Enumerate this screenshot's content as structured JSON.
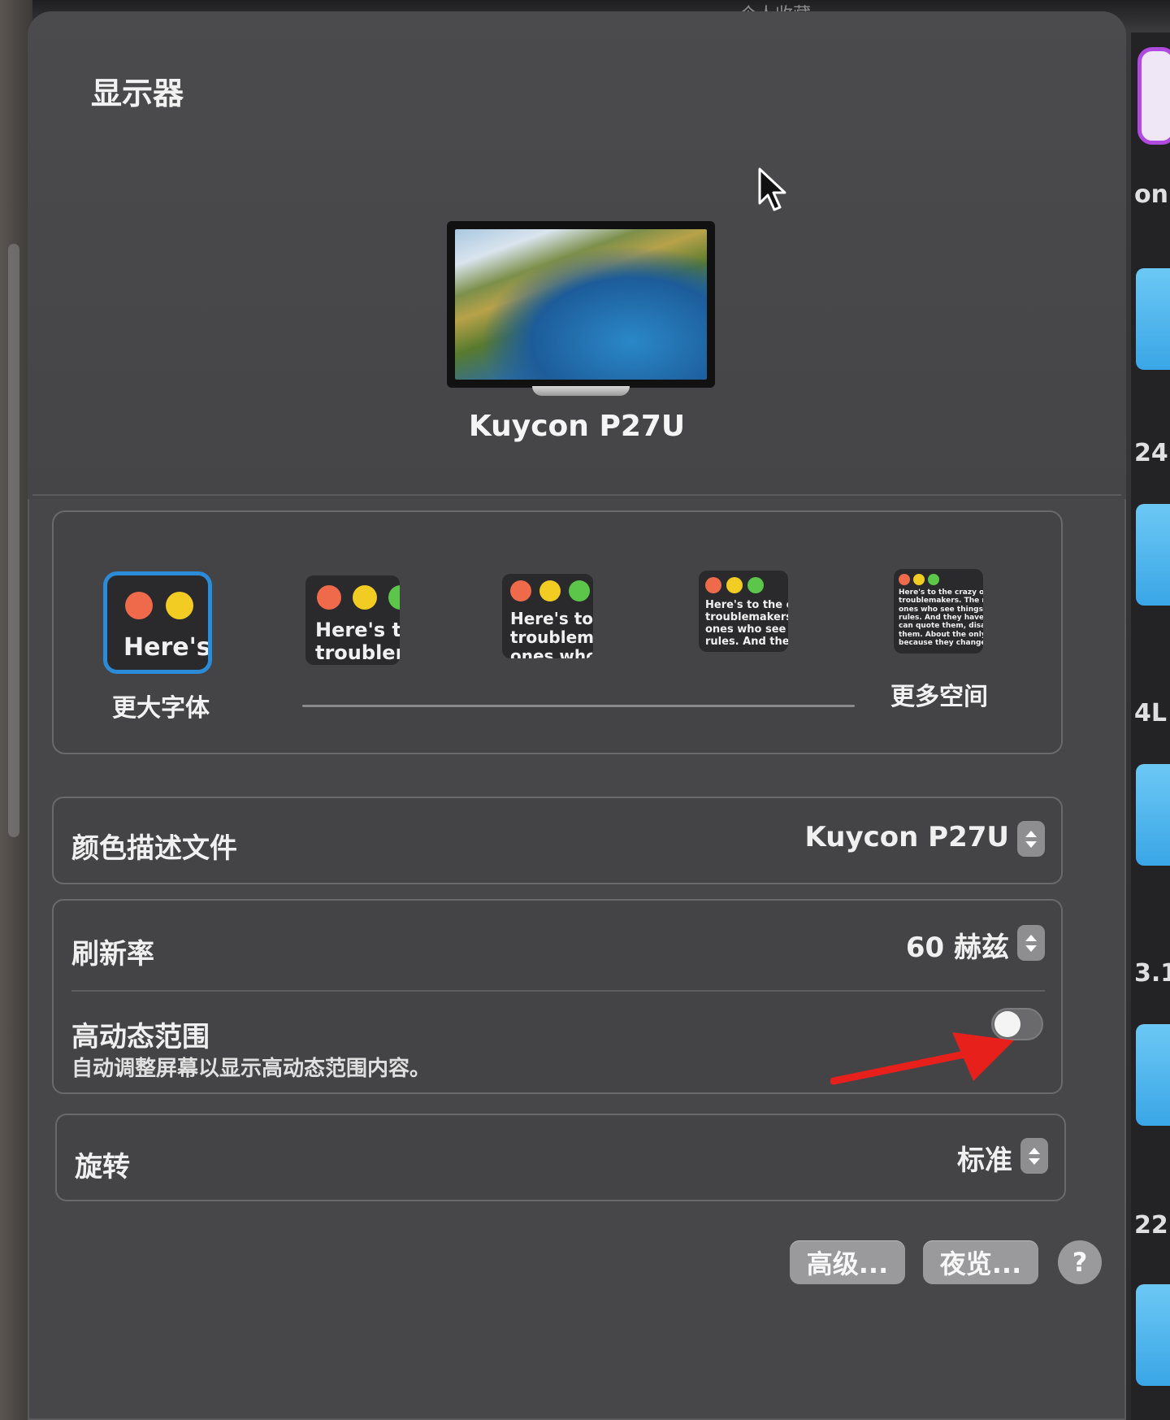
{
  "background": {
    "top_label": "个人收藏",
    "right_texts": [
      "onit",
      "24",
      "4L",
      "3.1",
      "22"
    ]
  },
  "window": {
    "title": "显示器"
  },
  "display": {
    "name": "Kuycon P27U"
  },
  "resolution": {
    "options": [
      {
        "thumb_text": "Here's",
        "selected": true
      },
      {
        "thumb_text": "Here's tc\ntroublem",
        "selected": false
      },
      {
        "thumb_text": "Here's to t\ntroublema\nones who",
        "selected": false
      },
      {
        "thumb_text": "Here's to the cr\ntroublemakers.\nones who see t\nrules. And they",
        "selected": false
      },
      {
        "thumb_text": "Here's to the crazy one\ntroublemakers. The rou\nones who see things dif\nrules. And they have no\ncan quote them, disagre\nthem. About the only th\nbecause they change it",
        "selected": false
      }
    ],
    "left_label": "更大字体",
    "right_label": "更多空间"
  },
  "settings": {
    "color_profile": {
      "label": "颜色描述文件",
      "value": "Kuycon P27U"
    },
    "refresh_rate": {
      "label": "刷新率",
      "value": "60 赫兹"
    },
    "hdr": {
      "label": "高动态范围",
      "description": "自动调整屏幕以显示高动态范围内容。",
      "enabled": false
    },
    "rotation": {
      "label": "旋转",
      "value": "标准"
    }
  },
  "buttons": {
    "advanced": "高级...",
    "night_shift": "夜览...",
    "help": "?"
  },
  "colors": {
    "selection_accent": "#2c8bd6",
    "annotation_arrow": "#e8201c"
  },
  "icons": {
    "cursor": "arrow-pointer",
    "stepper": "up-down-chevron",
    "help": "question-mark"
  }
}
